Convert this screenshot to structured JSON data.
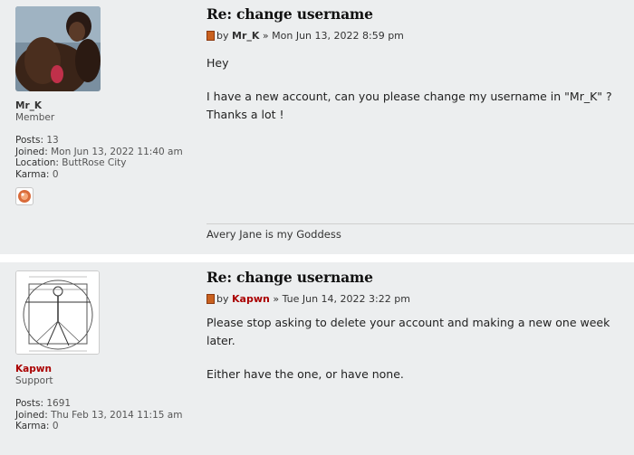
{
  "posts": [
    {
      "author": "Mr_K",
      "rank": "Member",
      "posts_label": "Posts:",
      "posts_value": "13",
      "joined_label": "Joined:",
      "joined_value": "Mon Jun 13, 2022 11:40 am",
      "location_label": "Location:",
      "location_value": "ButtRose City",
      "karma_label": "Karma:",
      "karma_value": "0",
      "title": "Re: change username",
      "by": "by",
      "sep": "»",
      "date": "Mon Jun 13, 2022 8:59 pm",
      "body": [
        "Hey",
        "I have a new account, can you please change my username in \"Mr_K\" ?",
        "Thanks a lot !"
      ],
      "signature": "Avery Jane is my Goddess"
    },
    {
      "author": "Kapwn",
      "rank": "Support",
      "posts_label": "Posts:",
      "posts_value": "1691",
      "joined_label": "Joined:",
      "joined_value": "Thu Feb 13, 2014 11:15 am",
      "karma_label": "Karma:",
      "karma_value": "0",
      "title": "Re: change username",
      "by": "by",
      "sep": "»",
      "date": "Tue Jun 14, 2022 3:22 pm",
      "body": [
        "Please stop asking to delete your account and making a new one week later.",
        "Either have the one, or have none."
      ]
    }
  ],
  "colors": {
    "post_bg": "#eceeef",
    "support_name": "#aa0000"
  },
  "icons": {
    "post_icon": "document-icon",
    "karma_icon": "karma-badge-icon"
  }
}
